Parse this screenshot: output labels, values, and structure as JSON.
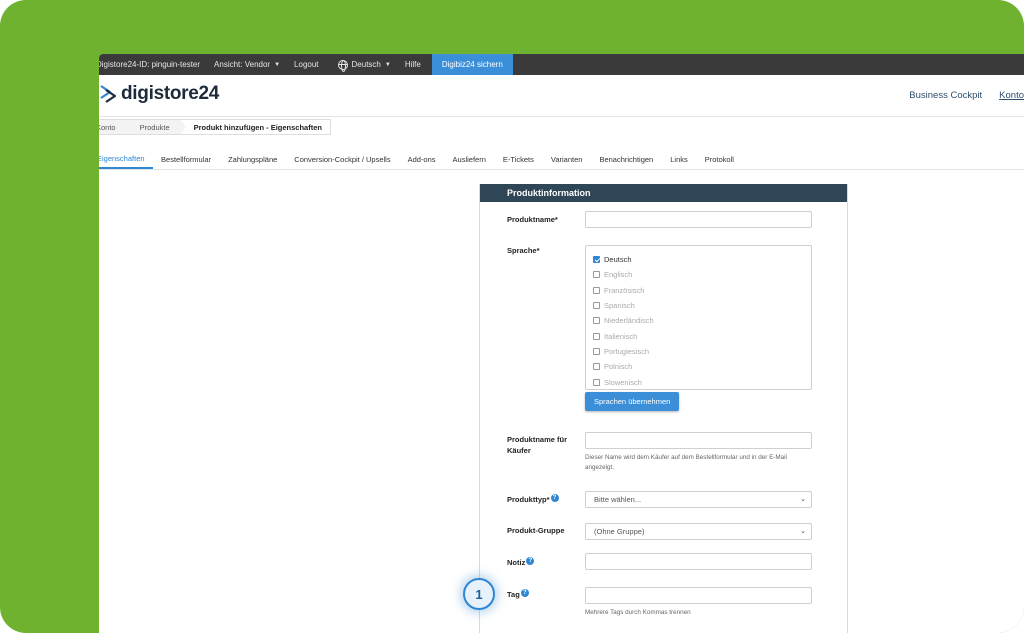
{
  "topbar": {
    "id_label": "Digistore24-ID: pinguin-tester",
    "view_label": "Ansicht: Vendor",
    "logout_label": "Logout",
    "language_label": "Deutsch",
    "help_label": "Hilfe",
    "secure_button": "Digibiz24 sichern"
  },
  "header": {
    "logo_text": "digistore24",
    "business_cockpit": "Business Cockpit",
    "account": "Konto"
  },
  "breadcrumb": [
    "Konto",
    "Produkte",
    "Produkt hinzufügen - Eigenschaften"
  ],
  "tabs": [
    "Eigenschaften",
    "Bestellformular",
    "Zahlungspläne",
    "Conversion-Cockpit / Upsells",
    "Add-ons",
    "Ausliefern",
    "E-Tickets",
    "Varianten",
    "Benachrichtigen",
    "Links",
    "Protokoll"
  ],
  "panel": {
    "title": "Produktinformation",
    "product_name_label": "Produktname*",
    "language_label": "Sprache*",
    "languages": [
      {
        "name": "Deutsch",
        "checked": true
      },
      {
        "name": "Englisch",
        "checked": false
      },
      {
        "name": "Französisch",
        "checked": false
      },
      {
        "name": "Spanisch",
        "checked": false
      },
      {
        "name": "Niederländisch",
        "checked": false
      },
      {
        "name": "Italienisch",
        "checked": false
      },
      {
        "name": "Portugiesisch",
        "checked": false
      },
      {
        "name": "Polnisch",
        "checked": false
      },
      {
        "name": "Slowenisch",
        "checked": false
      }
    ],
    "apply_languages_button": "Sprachen übernehmen",
    "buyer_name_label_line1": "Produktname für",
    "buyer_name_label_line2": "Käufer",
    "buyer_name_hint": "Dieser Name wird dem Käufer auf dem Bestellformular und in der E-Mail angezeigt.",
    "product_type_label": "Produkttyp*",
    "product_type_value": "Bitte wählen...",
    "product_group_label": "Produkt-Gruppe",
    "product_group_value": "(Ohne Gruppe)",
    "note_label": "Notiz",
    "tag_label": "Tag",
    "tag_hint": "Mehrere Tags durch Kommas trennen"
  },
  "step_marker": "1",
  "colors": {
    "frame_green": "#6fb22f",
    "topbar": "#3a3a3a",
    "accent_blue": "#3b8fd9",
    "panel_header": "#2e4656"
  }
}
